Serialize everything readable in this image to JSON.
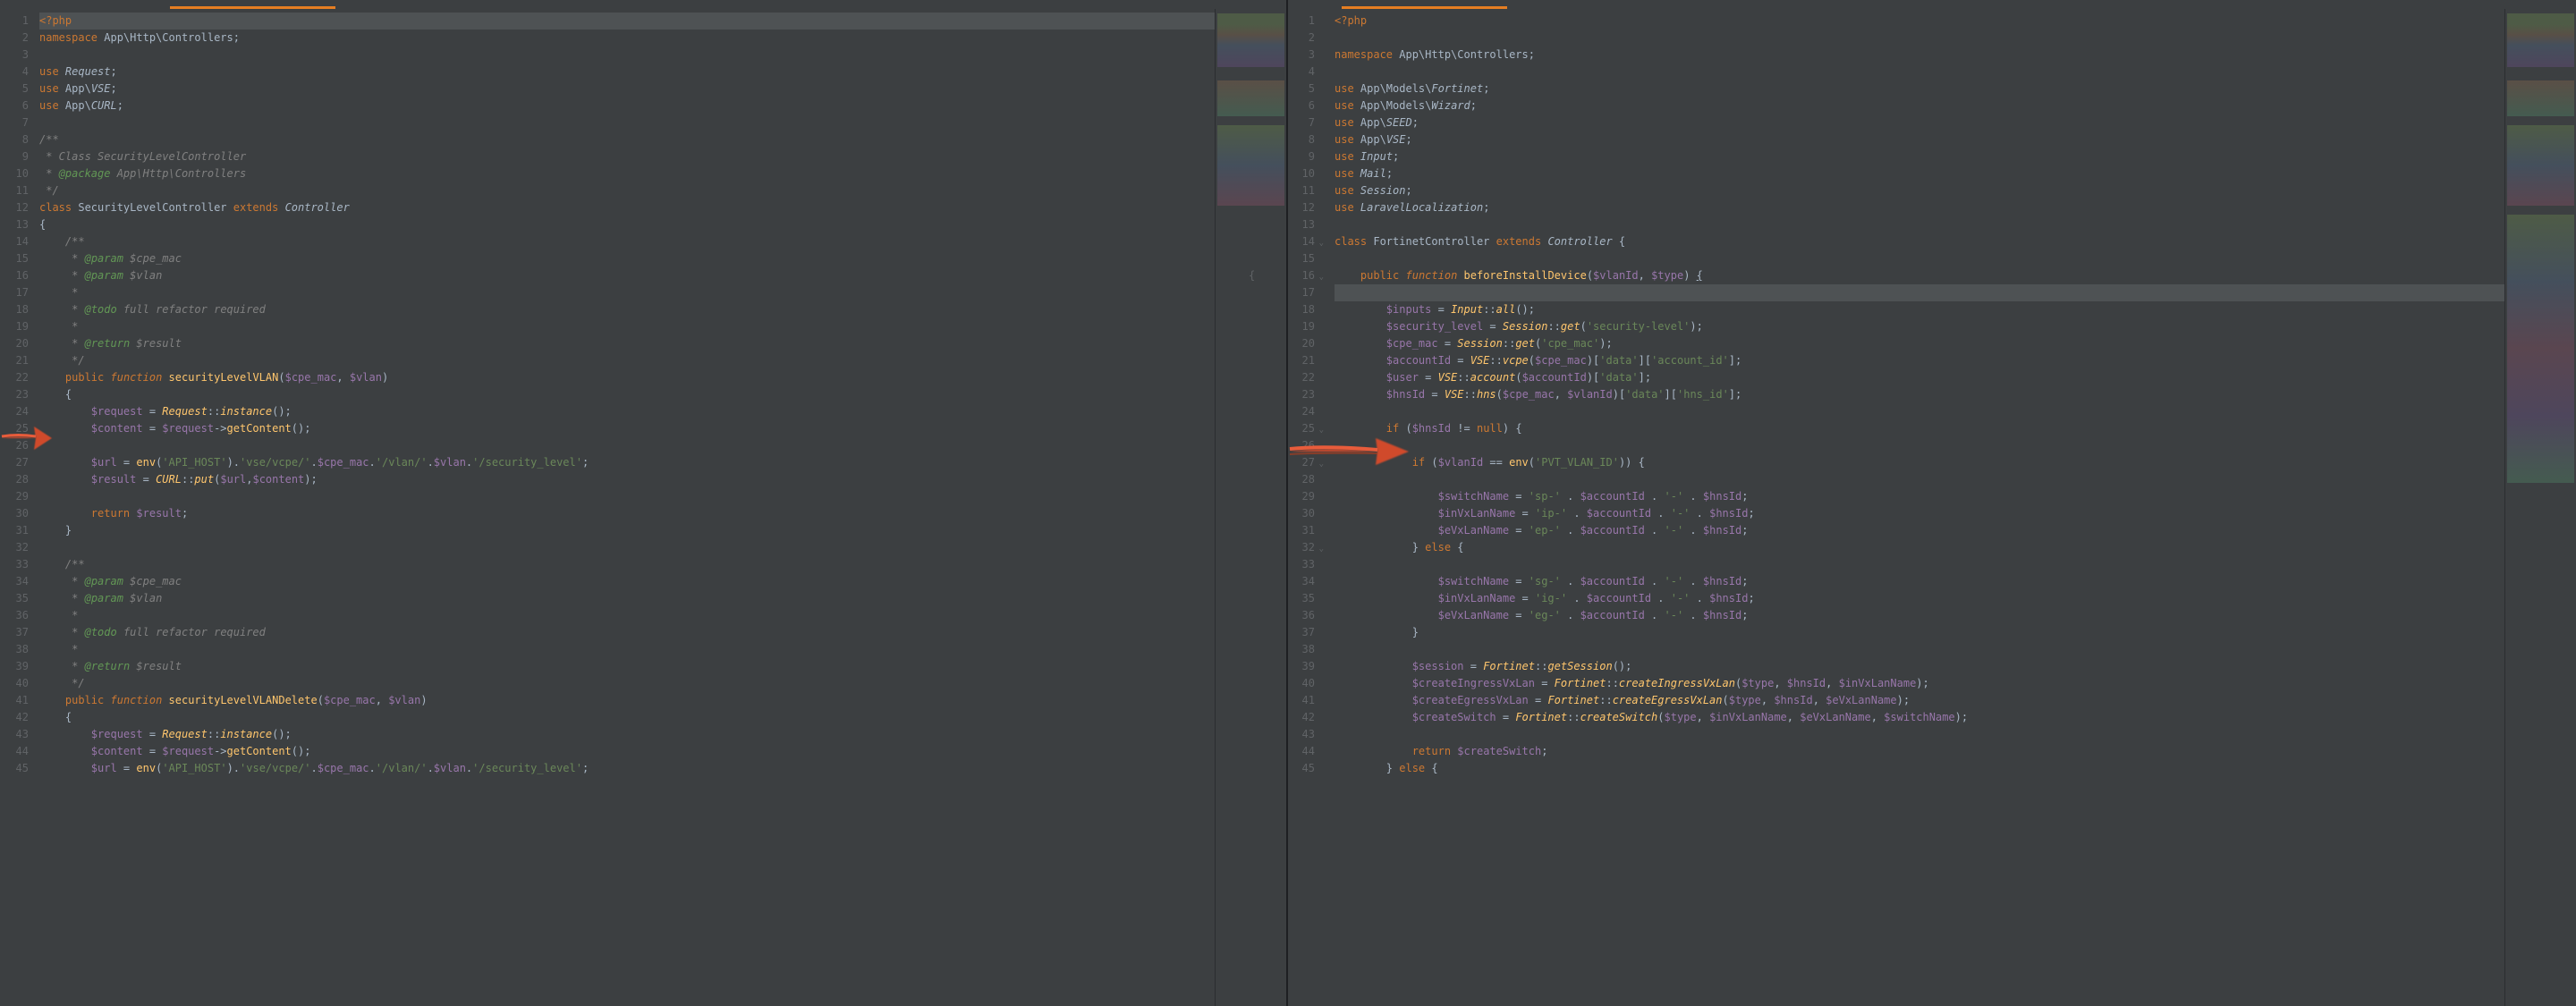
{
  "left": {
    "lines": [
      {
        "n": 1,
        "html": "<span class='pt'>&lt;?php</span>",
        "current": true
      },
      {
        "n": 2,
        "html": "<span class='kw2'>namespace</span> App\\Http\\Controllers;"
      },
      {
        "n": 3,
        "html": ""
      },
      {
        "n": 4,
        "html": "<span class='kw2'>use</span> <span class='cls'>Request</span>;"
      },
      {
        "n": 5,
        "html": "<span class='kw2'>use</span> App\\<span class='cls'>VSE</span>;"
      },
      {
        "n": 6,
        "html": "<span class='kw2'>use</span> App\\<span class='cls'>CURL</span>;"
      },
      {
        "n": 7,
        "html": ""
      },
      {
        "n": 8,
        "html": "<span class='com'>/**</span>"
      },
      {
        "n": 9,
        "html": "<span class='com'> * Class SecurityLevelController</span>"
      },
      {
        "n": 10,
        "html": "<span class='com'> * </span><span class='comkw'>@package</span><span class='com'> App\\Http\\Controllers</span>"
      },
      {
        "n": 11,
        "html": "<span class='com'> */</span>"
      },
      {
        "n": 12,
        "html": "<span class='kw2'>class</span> SecurityLevelController <span class='kw2'>extends</span> <span class='cls'>Controller</span>"
      },
      {
        "n": 13,
        "html": "{"
      },
      {
        "n": 14,
        "html": "    <span class='com'>/**</span>"
      },
      {
        "n": 15,
        "html": "    <span class='com'> * </span><span class='comkw'>@param</span><span class='com'> $cpe_mac</span>"
      },
      {
        "n": 16,
        "html": "    <span class='com'> * </span><span class='comkw'>@param</span><span class='com'> $vlan</span>"
      },
      {
        "n": 17,
        "html": "    <span class='com'> *</span>"
      },
      {
        "n": 18,
        "html": "    <span class='com'> * </span><span class='comkw'>@todo</span><span class='com'> full refactor required</span>"
      },
      {
        "n": 19,
        "html": "    <span class='com'> *</span>"
      },
      {
        "n": 20,
        "html": "    <span class='com'> * </span><span class='comkw'>@return</span><span class='com'> $result</span>"
      },
      {
        "n": 21,
        "html": "    <span class='com'> */</span>"
      },
      {
        "n": 22,
        "html": "    <span class='kw2'>public</span> <span class='kw'>function</span> <span class='fn'>securityLevelVLAN</span>(<span class='var'>$cpe_mac</span>, <span class='var'>$vlan</span>)"
      },
      {
        "n": 23,
        "html": "    {"
      },
      {
        "n": 24,
        "html": "        <span class='var'>$request</span> = <span class='cls2'>Request</span>::<span class='fn-i'>instance</span>();"
      },
      {
        "n": 25,
        "html": "        <span class='var'>$content</span> = <span class='var'>$request</span>-&gt;<span class='fn'>getContent</span>();"
      },
      {
        "n": 26,
        "html": ""
      },
      {
        "n": 27,
        "html": "        <span class='var'>$url</span> = <span class='fn'>env</span>(<span class='str'>'API_HOST'</span>).<span class='str'>'vse/vcpe/'</span>.<span class='var'>$cpe_mac</span>.<span class='str'>'/vlan/'</span>.<span class='var'>$vlan</span>.<span class='str'>'/security_level'</span>;"
      },
      {
        "n": 28,
        "html": "        <span class='var'>$result</span> = <span class='cls2'>CURL</span>::<span class='fn-i'>put</span>(<span class='var'>$url</span>,<span class='var'>$content</span>);"
      },
      {
        "n": 29,
        "html": ""
      },
      {
        "n": 30,
        "html": "        <span class='kw2'>return</span> <span class='var'>$result</span>;"
      },
      {
        "n": 31,
        "html": "    }"
      },
      {
        "n": 32,
        "html": ""
      },
      {
        "n": 33,
        "html": "    <span class='com'>/**</span>"
      },
      {
        "n": 34,
        "html": "    <span class='com'> * </span><span class='comkw'>@param</span><span class='com'> $cpe_mac</span>"
      },
      {
        "n": 35,
        "html": "    <span class='com'> * </span><span class='comkw'>@param</span><span class='com'> $vlan</span>"
      },
      {
        "n": 36,
        "html": "    <span class='com'> *</span>"
      },
      {
        "n": 37,
        "html": "    <span class='com'> * </span><span class='comkw'>@todo</span><span class='com'> full refactor required</span>"
      },
      {
        "n": 38,
        "html": "    <span class='com'> *</span>"
      },
      {
        "n": 39,
        "html": "    <span class='com'> * </span><span class='comkw'>@return</span><span class='com'> $result</span>"
      },
      {
        "n": 40,
        "html": "    <span class='com'> */</span>"
      },
      {
        "n": 41,
        "html": "    <span class='kw2'>public</span> <span class='kw'>function</span> <span class='fn'>securityLevelVLANDelete</span>(<span class='var'>$cpe_mac</span>, <span class='var'>$vlan</span>)"
      },
      {
        "n": 42,
        "html": "    {"
      },
      {
        "n": 43,
        "html": "        <span class='var'>$request</span> = <span class='cls2'>Request</span>::<span class='fn-i'>instance</span>();"
      },
      {
        "n": 44,
        "html": "        <span class='var'>$content</span> = <span class='var'>$request</span>-&gt;<span class='fn'>getContent</span>();"
      },
      {
        "n": 45,
        "html": "        <span class='var'>$url</span> = <span class='fn'>env</span>(<span class='str'>'API_HOST'</span>).<span class='str'>'vse/vcpe/'</span>.<span class='var'>$cpe_mac</span>.<span class='str'>'/vlan/'</span>.<span class='var'>$vlan</span>.<span class='str'>'/security_level'</span>;"
      }
    ]
  },
  "right": {
    "lines": [
      {
        "n": 1,
        "html": "<span class='pt'>&lt;?php</span>"
      },
      {
        "n": 2,
        "html": ""
      },
      {
        "n": 3,
        "html": "<span class='kw2'>namespace</span> App\\Http\\Controllers;"
      },
      {
        "n": 4,
        "html": ""
      },
      {
        "n": 5,
        "html": "<span class='kw2'>use</span> App\\Models\\<span class='cls'>Fortinet</span>;"
      },
      {
        "n": 6,
        "html": "<span class='kw2'>use</span> App\\Models\\<span class='cls'>Wizard</span>;"
      },
      {
        "n": 7,
        "html": "<span class='kw2'>use</span> App\\<span class='cls'>SEED</span>;"
      },
      {
        "n": 8,
        "html": "<span class='kw2'>use</span> App\\<span class='cls'>VSE</span>;"
      },
      {
        "n": 9,
        "html": "<span class='kw2'>use</span> <span class='cls'>Input</span>;"
      },
      {
        "n": 10,
        "html": "<span class='kw2'>use</span> <span class='cls'>Mail</span>;"
      },
      {
        "n": 11,
        "html": "<span class='kw2'>use</span> <span class='cls'>Session</span>;"
      },
      {
        "n": 12,
        "html": "<span class='kw2'>use</span> <span class='cls'>LaravelLocalization</span>;"
      },
      {
        "n": 13,
        "html": ""
      },
      {
        "n": 14,
        "html": "<span class='kw2'>class</span> FortinetController <span class='kw2'>extends</span> <span class='cls'>Controller</span> {",
        "fold": true
      },
      {
        "n": 15,
        "html": ""
      },
      {
        "n": 16,
        "html": "    <span class='kw2'>public</span> <span class='kw'>function</span> <span class='fn'>beforeInstallDevice</span>(<span class='var'>$vlanId</span>, <span class='var'>$type</span>) <u>{</u>",
        "fold": true,
        "brace": "{"
      },
      {
        "n": 17,
        "html": "",
        "current": true
      },
      {
        "n": 18,
        "html": "        <span class='var'>$inputs</span> = <span class='cls2'>Input</span>::<span class='fn-i'>all</span>();"
      },
      {
        "n": 19,
        "html": "        <span class='var'>$security_level</span> = <span class='cls2'>Session</span>::<span class='fn-i'>get</span>(<span class='str'>'security-level'</span>);"
      },
      {
        "n": 20,
        "html": "        <span class='var'>$cpe_mac</span> = <span class='cls2'>Session</span>::<span class='fn-i'>get</span>(<span class='str'>'cpe_mac'</span>);"
      },
      {
        "n": 21,
        "html": "        <span class='var'>$accountId</span> = <span class='cls2'>VSE</span>::<span class='fn-i'>vcpe</span>(<span class='var'>$cpe_mac</span>)[<span class='str'>'data'</span>][<span class='str'>'account_id'</span>];"
      },
      {
        "n": 22,
        "html": "        <span class='var'>$user</span> = <span class='cls2'>VSE</span>::<span class='fn-i'>account</span>(<span class='var'>$accountId</span>)[<span class='str'>'data'</span>];"
      },
      {
        "n": 23,
        "html": "        <span class='var'>$hnsId</span> = <span class='cls2'>VSE</span>::<span class='fn-i'>hns</span>(<span class='var'>$cpe_mac</span>, <span class='var'>$vlanId</span>)[<span class='str'>'data'</span>][<span class='str'>'hns_id'</span>];"
      },
      {
        "n": 24,
        "html": ""
      },
      {
        "n": 25,
        "html": "        <span class='kw2'>if</span> (<span class='var'>$hnsId</span> != <span class='kw2'>null</span>) {",
        "fold": true
      },
      {
        "n": 26,
        "html": ""
      },
      {
        "n": 27,
        "html": "            <span class='kw2'>if</span> (<span class='var'>$vlanId</span> == <span class='fn'>env</span>(<span class='str'>'PVT_VLAN_ID'</span>)) {",
        "fold": true
      },
      {
        "n": 28,
        "html": ""
      },
      {
        "n": 29,
        "html": "                <span class='var'>$switchName</span> = <span class='str'>'sp-'</span> . <span class='var'>$accountId</span> . <span class='str'>'-'</span> . <span class='var'>$hnsId</span>;"
      },
      {
        "n": 30,
        "html": "                <span class='var'>$inVxLanName</span> = <span class='str'>'ip-'</span> . <span class='var'>$accountId</span> . <span class='str'>'-'</span> . <span class='var'>$hnsId</span>;"
      },
      {
        "n": 31,
        "html": "                <span class='var'>$eVxLanName</span> = <span class='str'>'ep-'</span> . <span class='var'>$accountId</span> . <span class='str'>'-'</span> . <span class='var'>$hnsId</span>;"
      },
      {
        "n": 32,
        "html": "            } <span class='kw2'>else</span> {",
        "fold": true
      },
      {
        "n": 33,
        "html": ""
      },
      {
        "n": 34,
        "html": "                <span class='var'>$switchName</span> = <span class='str'>'sg-'</span> . <span class='var'>$accountId</span> . <span class='str'>'-'</span> . <span class='var'>$hnsId</span>;"
      },
      {
        "n": 35,
        "html": "                <span class='var'>$inVxLanName</span> = <span class='str'>'ig-'</span> . <span class='var'>$accountId</span> . <span class='str'>'-'</span> . <span class='var'>$hnsId</span>;"
      },
      {
        "n": 36,
        "html": "                <span class='var'>$eVxLanName</span> = <span class='str'>'eg-'</span> . <span class='var'>$accountId</span> . <span class='str'>'-'</span> . <span class='var'>$hnsId</span>;"
      },
      {
        "n": 37,
        "html": "            }"
      },
      {
        "n": 38,
        "html": ""
      },
      {
        "n": 39,
        "html": "            <span class='var'>$session</span> = <span class='cls2'>Fortinet</span>::<span class='fn-i'>getSession</span>();"
      },
      {
        "n": 40,
        "html": "            <span class='var'>$createIngressVxLan</span> = <span class='cls2'>Fortinet</span>::<span class='fn-i'>createIngressVxLan</span>(<span class='var'>$type</span>, <span class='var'>$hnsId</span>, <span class='var'>$inVxLanName</span>);"
      },
      {
        "n": 41,
        "html": "            <span class='var'>$createEgressVxLan</span> = <span class='cls2'>Fortinet</span>::<span class='fn-i'>createEgressVxLan</span>(<span class='var'>$type</span>, <span class='var'>$hnsId</span>, <span class='var'>$eVxLanName</span>);"
      },
      {
        "n": 42,
        "html": "            <span class='var'>$createSwitch</span> = <span class='cls2'>Fortinet</span>::<span class='fn-i'>createSwitch</span>(<span class='var'>$type</span>, <span class='var'>$inVxLanName</span>, <span class='var'>$eVxLanName</span>, <span class='var'>$switchName</span>);"
      },
      {
        "n": 43,
        "html": ""
      },
      {
        "n": 44,
        "html": "            <span class='kw2'>return</span> <span class='var'>$createSwitch</span>;"
      },
      {
        "n": 45,
        "html": "        } <span class='kw2'>else</span> {"
      }
    ]
  },
  "colors": {
    "arrow": "#d84c2b"
  }
}
